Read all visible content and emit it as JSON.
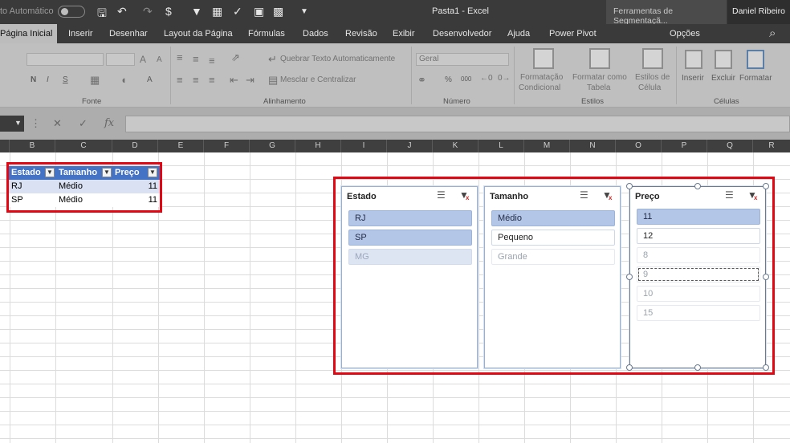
{
  "titlebar": {
    "autosave": "to Automático",
    "doc_title": "Pasta1  -  Excel",
    "context_tab": "Ferramentas de Segmentaçã...",
    "user": "Daniel Ribeiro"
  },
  "tabs": [
    "Página Inicial",
    "Inserir",
    "Desenhar",
    "Layout da Página",
    "Fórmulas",
    "Dados",
    "Revisão",
    "Exibir",
    "Desenvolvedor",
    "Ajuda",
    "Power Pivot",
    "Opções"
  ],
  "ribbon": {
    "font_group": "Fonte",
    "alignment_group": "Alinhamento",
    "number_group": "Número",
    "styles_group": "Estilos",
    "cells_group": "Células",
    "wrap_text": "Quebrar Texto Automaticamente",
    "merge_center": "Mesclar e Centralizar",
    "number_format": "Geral",
    "conditional_format": [
      "Formatação",
      "Condicional"
    ],
    "format_table": [
      "Formatar como",
      "Tabela"
    ],
    "cell_styles": [
      "Estilos de",
      "Célula"
    ],
    "insert": "Inserir",
    "delete": "Excluir",
    "format": "Formatar",
    "bold": "N",
    "italic": "I",
    "underline": "S",
    "font_grow": "A",
    "font_shrink": "A",
    "percent": "%",
    "thousands": "000"
  },
  "formula": {
    "fx": "fx"
  },
  "columns": [
    "B",
    "C",
    "D",
    "E",
    "F",
    "G",
    "H",
    "I",
    "J",
    "K",
    "L",
    "M",
    "N",
    "O",
    "P",
    "Q",
    "R"
  ],
  "table": {
    "headers": [
      "Estado",
      "Tamanho",
      "Preço"
    ],
    "rows": [
      [
        "RJ",
        "Médio",
        "11"
      ],
      [
        "SP",
        "Médio",
        "11"
      ]
    ]
  },
  "slicers": [
    {
      "title": "Estado",
      "items": [
        {
          "label": "RJ",
          "state": "sel"
        },
        {
          "label": "SP",
          "state": "sel"
        },
        {
          "label": "MG",
          "state": "nodata-shade"
        }
      ]
    },
    {
      "title": "Tamanho",
      "items": [
        {
          "label": "Médio",
          "state": "sel"
        },
        {
          "label": "Pequeno",
          "state": "avail"
        },
        {
          "label": "Grande",
          "state": "nodata"
        }
      ]
    },
    {
      "title": "Preço",
      "items": [
        {
          "label": "11",
          "state": "sel"
        },
        {
          "label": "12",
          "state": "avail"
        },
        {
          "label": "8",
          "state": "nodata"
        },
        {
          "label": "9",
          "state": "nodata"
        },
        {
          "label": "10",
          "state": "nodata"
        },
        {
          "label": "15",
          "state": "nodata"
        }
      ]
    }
  ],
  "colors": {
    "table_header": "#4472c4",
    "table_band": "#d9e1f2",
    "slicer_selected": "#b4c6e7",
    "highlight_box": "#e30613"
  }
}
